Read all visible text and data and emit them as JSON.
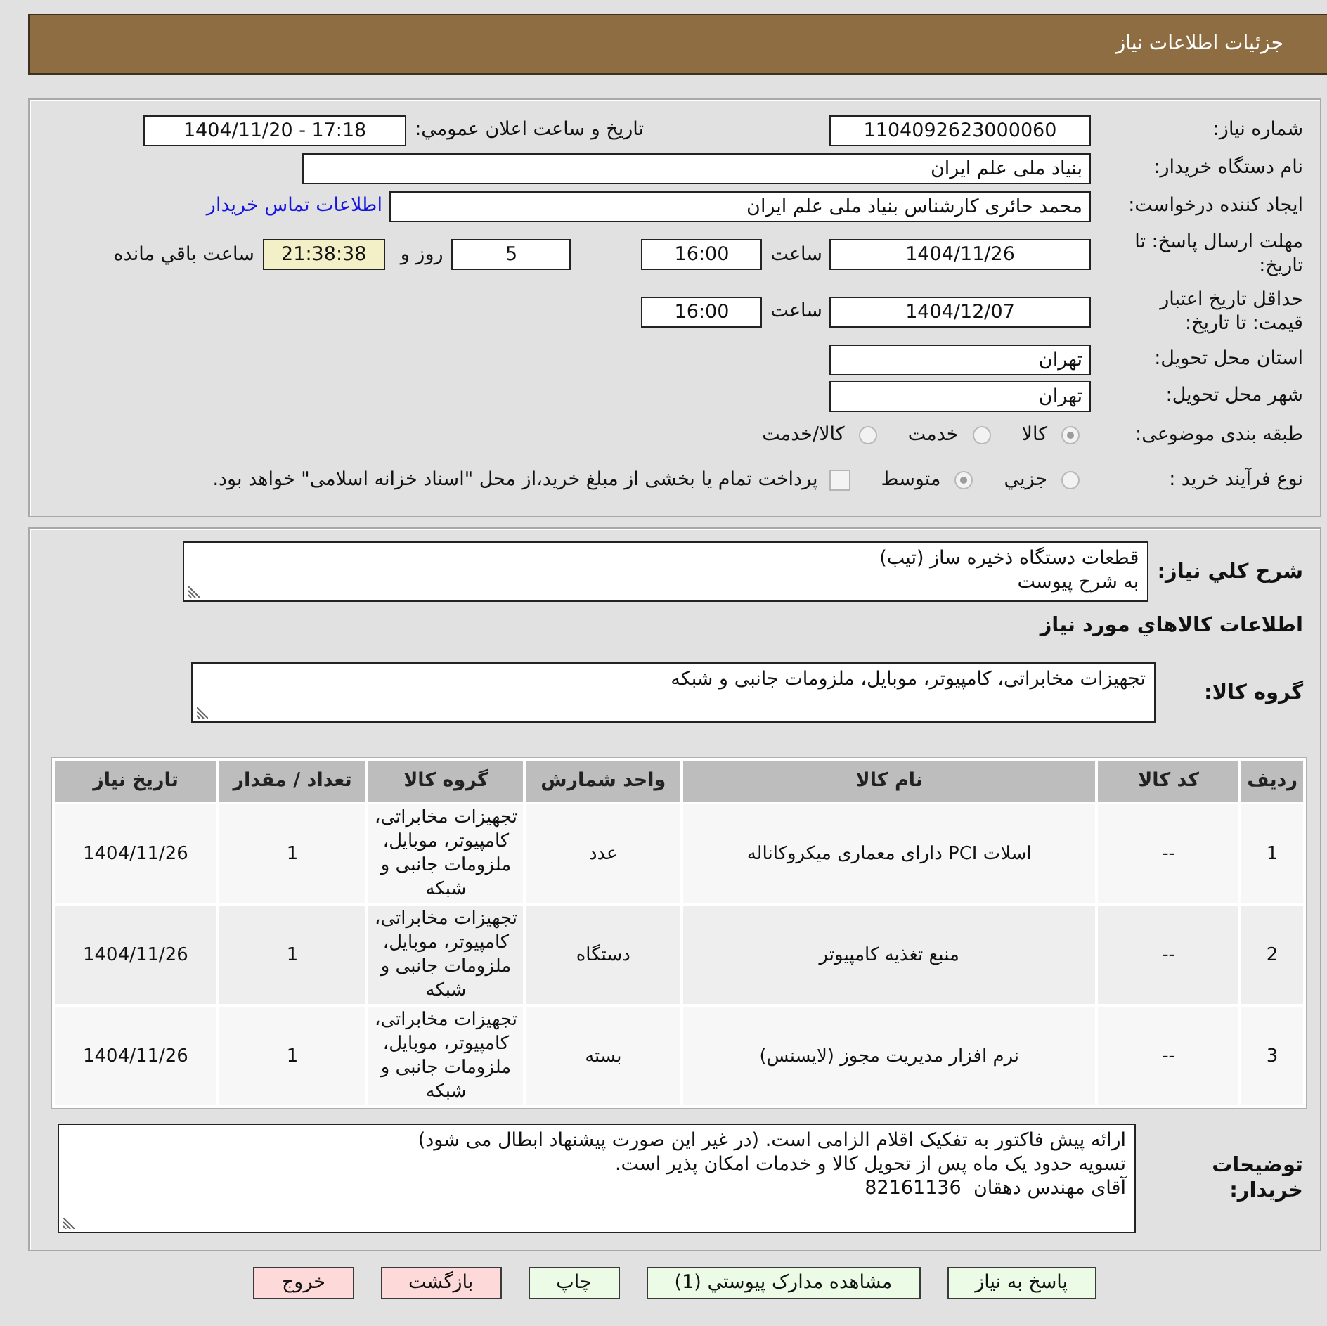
{
  "header": {
    "title": "جزئیات اطلاعات نیاز"
  },
  "details": {
    "need_number": {
      "label": "شماره نیاز:",
      "value": "1104092623000060"
    },
    "announcement": {
      "label": "تاریخ و ساعت اعلان عمومي:",
      "value": "1404/11/20 - 17:18"
    },
    "buyer_organization": {
      "label": "نام دستگاه خریدار:",
      "value": "بنیاد ملی علم ایران"
    },
    "requester": {
      "label": "ایجاد کننده درخواست:",
      "value": "محمد حائری کارشناس بنیاد ملی علم ایران",
      "contact_link": "اطلاعات تماس خریدار"
    },
    "reply_deadline": {
      "label": "مهلت ارسال پاسخ: تا تاریخ:",
      "date": "1404/11/26",
      "time_label": "ساعت",
      "time": "16:00",
      "days": "5",
      "days_label": "روز و",
      "remaining": "21:38:38",
      "remaining_label": "ساعت باقي مانده"
    },
    "price_validity": {
      "label": "حداقل تاریخ اعتبار قیمت: تا تاریخ:",
      "date": "1404/12/07",
      "time_label": "ساعت",
      "time": "16:00"
    },
    "province": {
      "label": "استان محل تحویل:",
      "value": "تهران"
    },
    "city": {
      "label": "شهر محل تحویل:",
      "value": "تهران"
    },
    "subject_category": {
      "label": "طبقه بندی موضوعی:",
      "disabled": true,
      "options": [
        {
          "label": "کالا",
          "selected": true
        },
        {
          "label": "خدمت",
          "selected": false
        },
        {
          "label": "کالا/خدمت",
          "selected": false
        }
      ]
    },
    "purchase_process": {
      "label": "نوع فرآیند خرید :",
      "disabled": true,
      "options": [
        {
          "label": "جزيي",
          "selected": false
        },
        {
          "label": "متوسط",
          "selected": true
        }
      ],
      "treasury_payment": {
        "label": "پرداخت تمام یا بخشی از مبلغ خرید،از محل \"اسناد خزانه اسلامی\" خواهد بود.",
        "checked": false
      }
    }
  },
  "items": {
    "description": {
      "label": "شرح كلي نیاز:",
      "value": "قطعات دستگاه ذخیره ساز (تیب)\nبه شرح پیوست"
    },
    "section_title": "اطلاعات كالاهاي مورد نیاز",
    "goods_group": {
      "label": "گروه کالا:",
      "value": "تجهیزات مخابراتی، کامپیوتر، موبایل، ملزومات جانبی و شبکه"
    },
    "table": {
      "columns": [
        "ردیف",
        "کد کالا",
        "نام کالا",
        "واحد شمارش",
        "گروه کالا",
        "تعداد / مقدار",
        "تاریخ نیاز"
      ],
      "rows": [
        {
          "cells": [
            "1",
            "--",
            "اسلات PCI دارای معماری میکروکاناله",
            "عدد",
            "تجهیزات مخابراتی، کامپیوتر، موبایل، ملزومات جانبی و شبکه",
            "1",
            "1404/11/26"
          ]
        },
        {
          "cells": [
            "2",
            "--",
            "منبع تغذیه کامپیوتر",
            "دستگاه",
            "تجهیزات مخابراتی، کامپیوتر، موبایل، ملزومات جانبی و شبکه",
            "1",
            "1404/11/26"
          ]
        },
        {
          "cells": [
            "3",
            "--",
            "نرم افزار مدیریت مجوز (لایسنس)",
            "بسته",
            "تجهیزات مخابراتی، کامپیوتر، موبایل، ملزومات جانبی و شبکه",
            "1",
            "1404/11/26"
          ]
        }
      ]
    },
    "buyer_notes": {
      "label": "توضیحات خریدار:",
      "value": "ارائه پیش فاکتور به تفکیک اقلام الزامی است. (در غیر این صورت پیشنهاد ابطال می شود)\nتسویه حدود یک ماه پس از تحویل کالا و خدمات امکان پذیر است.\nآقای مهندس دهقان  82161136"
    }
  },
  "buttons": [
    {
      "label": "پاسخ به نیاز",
      "kind": "action"
    },
    {
      "label": "مشاهده مدارک پیوستي (1)",
      "kind": "action"
    },
    {
      "label": "چاپ",
      "kind": "action"
    },
    {
      "label": "بازگشت",
      "kind": "leave"
    },
    {
      "label": "خروج",
      "kind": "leave"
    }
  ]
}
